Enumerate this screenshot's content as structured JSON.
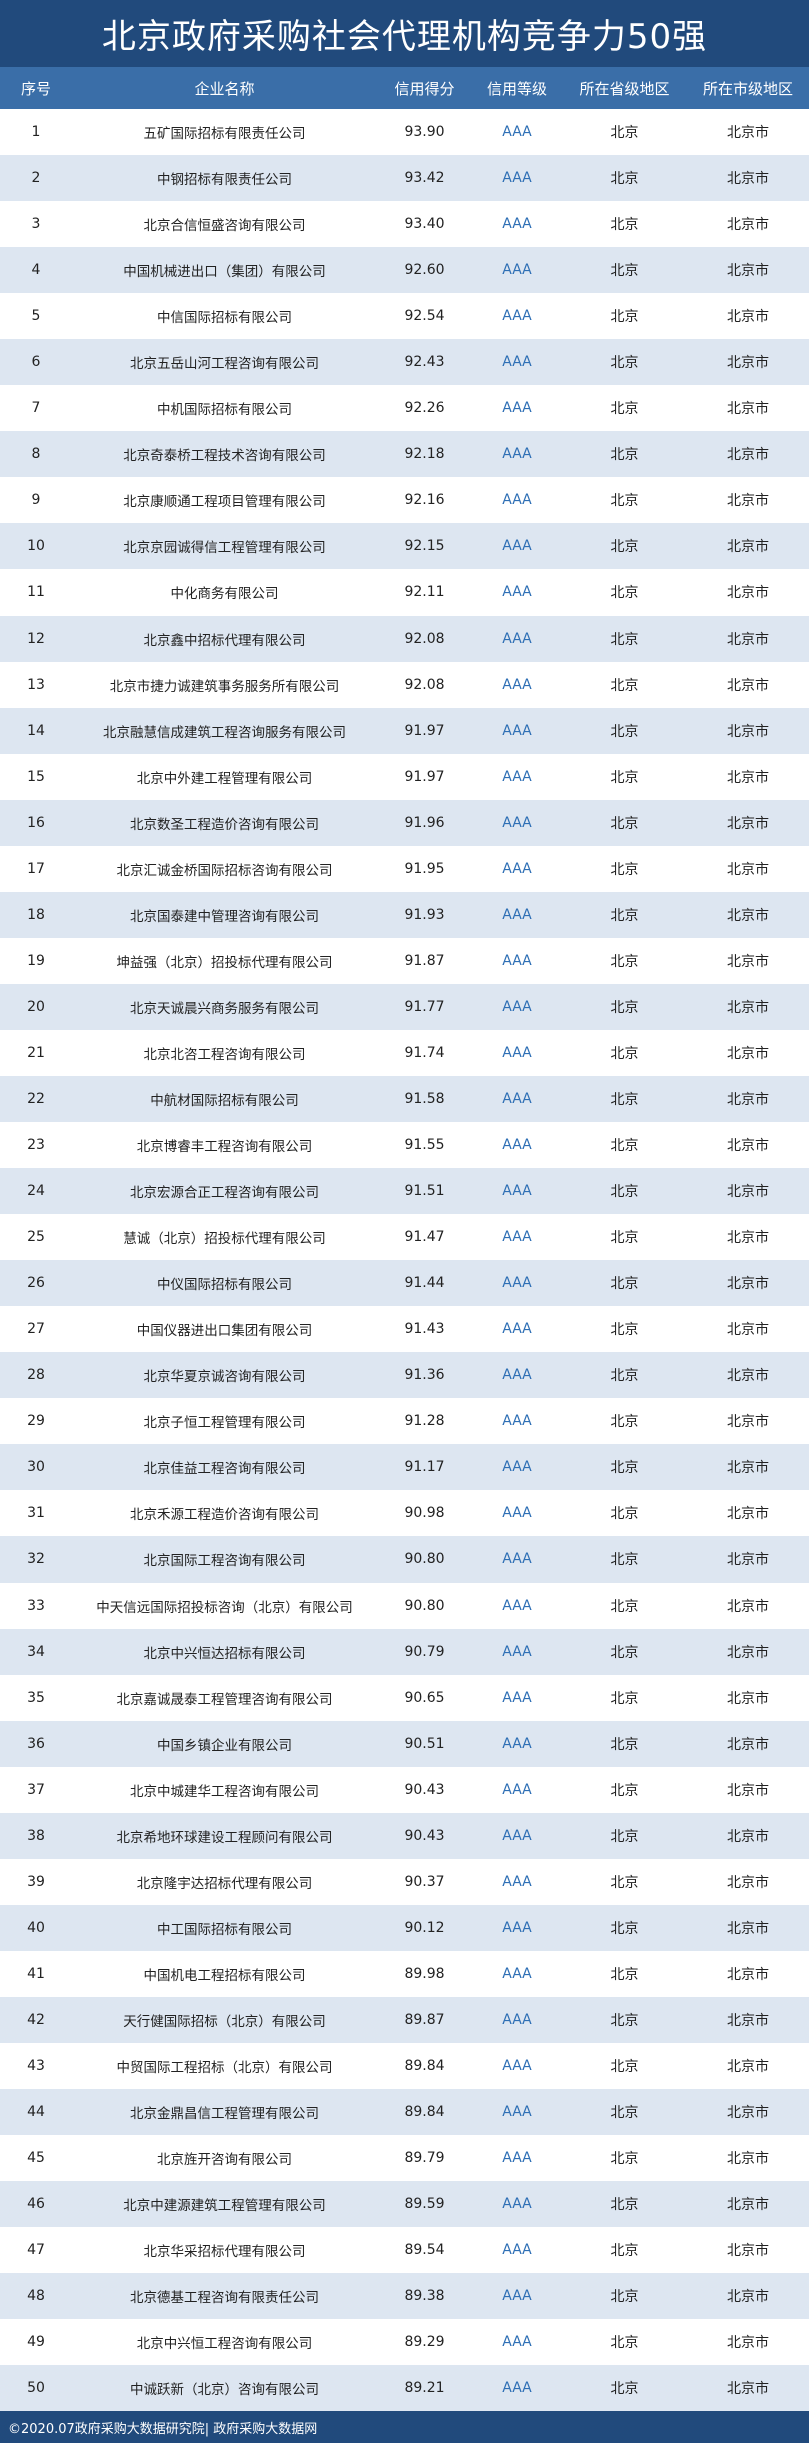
{
  "title": "北京政府采购社会代理机构竞争力50强",
  "headers": {
    "rank": "序号",
    "name": "企业名称",
    "score": "信用得分",
    "grade": "信用等级",
    "province": "所在省级地区",
    "city": "所在市级地区"
  },
  "rows": [
    {
      "rank": "1",
      "name": "五矿国际招标有限责任公司",
      "score": "93.90",
      "grade": "AAA",
      "province": "北京",
      "city": "北京市"
    },
    {
      "rank": "2",
      "name": "中钢招标有限责任公司",
      "score": "93.42",
      "grade": "AAA",
      "province": "北京",
      "city": "北京市"
    },
    {
      "rank": "3",
      "name": "北京合信恒盛咨询有限公司",
      "score": "93.40",
      "grade": "AAA",
      "province": "北京",
      "city": "北京市"
    },
    {
      "rank": "4",
      "name": "中国机械进出口（集团）有限公司",
      "score": "92.60",
      "grade": "AAA",
      "province": "北京",
      "city": "北京市"
    },
    {
      "rank": "5",
      "name": "中信国际招标有限公司",
      "score": "92.54",
      "grade": "AAA",
      "province": "北京",
      "city": "北京市"
    },
    {
      "rank": "6",
      "name": "北京五岳山河工程咨询有限公司",
      "score": "92.43",
      "grade": "AAA",
      "province": "北京",
      "city": "北京市"
    },
    {
      "rank": "7",
      "name": "中机国际招标有限公司",
      "score": "92.26",
      "grade": "AAA",
      "province": "北京",
      "city": "北京市"
    },
    {
      "rank": "8",
      "name": "北京奇泰桥工程技术咨询有限公司",
      "score": "92.18",
      "grade": "AAA",
      "province": "北京",
      "city": "北京市"
    },
    {
      "rank": "9",
      "name": "北京康顺通工程项目管理有限公司",
      "score": "92.16",
      "grade": "AAA",
      "province": "北京",
      "city": "北京市"
    },
    {
      "rank": "10",
      "name": "北京京园诚得信工程管理有限公司",
      "score": "92.15",
      "grade": "AAA",
      "province": "北京",
      "city": "北京市"
    },
    {
      "rank": "11",
      "name": "中化商务有限公司",
      "score": "92.11",
      "grade": "AAA",
      "province": "北京",
      "city": "北京市"
    },
    {
      "rank": "12",
      "name": "北京鑫中招标代理有限公司",
      "score": "92.08",
      "grade": "AAA",
      "province": "北京",
      "city": "北京市"
    },
    {
      "rank": "13",
      "name": "北京市捷力诚建筑事务服务所有限公司",
      "score": "92.08",
      "grade": "AAA",
      "province": "北京",
      "city": "北京市"
    },
    {
      "rank": "14",
      "name": "北京融慧信成建筑工程咨询服务有限公司",
      "score": "91.97",
      "grade": "AAA",
      "province": "北京",
      "city": "北京市"
    },
    {
      "rank": "15",
      "name": "北京中外建工程管理有限公司",
      "score": "91.97",
      "grade": "AAA",
      "province": "北京",
      "city": "北京市"
    },
    {
      "rank": "16",
      "name": "北京数圣工程造价咨询有限公司",
      "score": "91.96",
      "grade": "AAA",
      "province": "北京",
      "city": "北京市"
    },
    {
      "rank": "17",
      "name": "北京汇诚金桥国际招标咨询有限公司",
      "score": "91.95",
      "grade": "AAA",
      "province": "北京",
      "city": "北京市"
    },
    {
      "rank": "18",
      "name": "北京国泰建中管理咨询有限公司",
      "score": "91.93",
      "grade": "AAA",
      "province": "北京",
      "city": "北京市"
    },
    {
      "rank": "19",
      "name": "坤益强（北京）招投标代理有限公司",
      "score": "91.87",
      "grade": "AAA",
      "province": "北京",
      "city": "北京市"
    },
    {
      "rank": "20",
      "name": "北京天诚晨兴商务服务有限公司",
      "score": "91.77",
      "grade": "AAA",
      "province": "北京",
      "city": "北京市"
    },
    {
      "rank": "21",
      "name": "北京北咨工程咨询有限公司",
      "score": "91.74",
      "grade": "AAA",
      "province": "北京",
      "city": "北京市"
    },
    {
      "rank": "22",
      "name": "中航材国际招标有限公司",
      "score": "91.58",
      "grade": "AAA",
      "province": "北京",
      "city": "北京市"
    },
    {
      "rank": "23",
      "name": "北京博睿丰工程咨询有限公司",
      "score": "91.55",
      "grade": "AAA",
      "province": "北京",
      "city": "北京市"
    },
    {
      "rank": "24",
      "name": "北京宏源合正工程咨询有限公司",
      "score": "91.51",
      "grade": "AAA",
      "province": "北京",
      "city": "北京市"
    },
    {
      "rank": "25",
      "name": "慧诚（北京）招投标代理有限公司",
      "score": "91.47",
      "grade": "AAA",
      "province": "北京",
      "city": "北京市"
    },
    {
      "rank": "26",
      "name": "中仪国际招标有限公司",
      "score": "91.44",
      "grade": "AAA",
      "province": "北京",
      "city": "北京市"
    },
    {
      "rank": "27",
      "name": "中国仪器进出口集团有限公司",
      "score": "91.43",
      "grade": "AAA",
      "province": "北京",
      "city": "北京市"
    },
    {
      "rank": "28",
      "name": "北京华夏京诚咨询有限公司",
      "score": "91.36",
      "grade": "AAA",
      "province": "北京",
      "city": "北京市"
    },
    {
      "rank": "29",
      "name": "北京子恒工程管理有限公司",
      "score": "91.28",
      "grade": "AAA",
      "province": "北京",
      "city": "北京市"
    },
    {
      "rank": "30",
      "name": "北京佳益工程咨询有限公司",
      "score": "91.17",
      "grade": "AAA",
      "province": "北京",
      "city": "北京市"
    },
    {
      "rank": "31",
      "name": "北京禾源工程造价咨询有限公司",
      "score": "90.98",
      "grade": "AAA",
      "province": "北京",
      "city": "北京市"
    },
    {
      "rank": "32",
      "name": "北京国际工程咨询有限公司",
      "score": "90.80",
      "grade": "AAA",
      "province": "北京",
      "city": "北京市"
    },
    {
      "rank": "33",
      "name": "中天信远国际招投标咨询（北京）有限公司",
      "score": "90.80",
      "grade": "AAA",
      "province": "北京",
      "city": "北京市"
    },
    {
      "rank": "34",
      "name": "北京中兴恒达招标有限公司",
      "score": "90.79",
      "grade": "AAA",
      "province": "北京",
      "city": "北京市"
    },
    {
      "rank": "35",
      "name": "北京嘉诚晟泰工程管理咨询有限公司",
      "score": "90.65",
      "grade": "AAA",
      "province": "北京",
      "city": "北京市"
    },
    {
      "rank": "36",
      "name": "中国乡镇企业有限公司",
      "score": "90.51",
      "grade": "AAA",
      "province": "北京",
      "city": "北京市"
    },
    {
      "rank": "37",
      "name": "北京中城建华工程咨询有限公司",
      "score": "90.43",
      "grade": "AAA",
      "province": "北京",
      "city": "北京市"
    },
    {
      "rank": "38",
      "name": "北京希地环球建设工程顾问有限公司",
      "score": "90.43",
      "grade": "AAA",
      "province": "北京",
      "city": "北京市"
    },
    {
      "rank": "39",
      "name": "北京隆宇达招标代理有限公司",
      "score": "90.37",
      "grade": "AAA",
      "province": "北京",
      "city": "北京市"
    },
    {
      "rank": "40",
      "name": "中工国际招标有限公司",
      "score": "90.12",
      "grade": "AAA",
      "province": "北京",
      "city": "北京市"
    },
    {
      "rank": "41",
      "name": "中国机电工程招标有限公司",
      "score": "89.98",
      "grade": "AAA",
      "province": "北京",
      "city": "北京市"
    },
    {
      "rank": "42",
      "name": "天行健国际招标（北京）有限公司",
      "score": "89.87",
      "grade": "AAA",
      "province": "北京",
      "city": "北京市"
    },
    {
      "rank": "43",
      "name": "中贸国际工程招标（北京）有限公司",
      "score": "89.84",
      "grade": "AAA",
      "province": "北京",
      "city": "北京市"
    },
    {
      "rank": "44",
      "name": "北京金鼎昌信工程管理有限公司",
      "score": "89.84",
      "grade": "AAA",
      "province": "北京",
      "city": "北京市"
    },
    {
      "rank": "45",
      "name": "北京旌开咨询有限公司",
      "score": "89.79",
      "grade": "AAA",
      "province": "北京",
      "city": "北京市"
    },
    {
      "rank": "46",
      "name": "北京中建源建筑工程管理有限公司",
      "score": "89.59",
      "grade": "AAA",
      "province": "北京",
      "city": "北京市"
    },
    {
      "rank": "47",
      "name": "北京华采招标代理有限公司",
      "score": "89.54",
      "grade": "AAA",
      "province": "北京",
      "city": "北京市"
    },
    {
      "rank": "48",
      "name": "北京德基工程咨询有限责任公司",
      "score": "89.38",
      "grade": "AAA",
      "province": "北京",
      "city": "北京市"
    },
    {
      "rank": "49",
      "name": "北京中兴恒工程咨询有限公司",
      "score": "89.29",
      "grade": "AAA",
      "province": "北京",
      "city": "北京市"
    },
    {
      "rank": "50",
      "name": "中诚跃新（北京）咨询有限公司",
      "score": "89.21",
      "grade": "AAA",
      "province": "北京",
      "city": "北京市"
    }
  ],
  "footer": "©2020.07政府采购大数据研究院| 政府采购大数据网",
  "colors": {
    "title_bg": "#214a7c",
    "header_bg": "#3a6ea8",
    "row_alt_bg": "#dde6f1",
    "grade_text": "#2e6fb5"
  }
}
